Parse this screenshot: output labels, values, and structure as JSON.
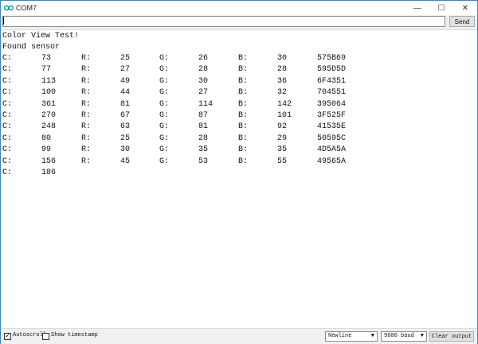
{
  "window": {
    "title": "COM7",
    "minimize": "—",
    "maximize": "☐",
    "close": "✕",
    "app_icon": "arduino-infinity-icon"
  },
  "send_row": {
    "input_value": "",
    "send_label": "Send"
  },
  "output": {
    "header_lines": [
      "Color View Test!",
      "Found sensor"
    ],
    "rows": [
      [
        "C:",
        "73",
        "R:",
        "25",
        "G:",
        "26",
        "B:",
        "30",
        "575B69"
      ],
      [
        "C:",
        "77",
        "R:",
        "27",
        "G:",
        "28",
        "B:",
        "28",
        "595D5D"
      ],
      [
        "C:",
        "113",
        "R:",
        "49",
        "G:",
        "30",
        "B:",
        "36",
        "6F4351"
      ],
      [
        "C:",
        "100",
        "R:",
        "44",
        "G:",
        "27",
        "B:",
        "32",
        "704551"
      ],
      [
        "C:",
        "361",
        "R:",
        "81",
        "G:",
        "114",
        "B:",
        "142",
        "395064"
      ],
      [
        "C:",
        "270",
        "R:",
        "67",
        "G:",
        "87",
        "B:",
        "101",
        "3F525F"
      ],
      [
        "C:",
        "248",
        "R:",
        "63",
        "G:",
        "81",
        "B:",
        "92",
        "41535E"
      ],
      [
        "C:",
        "80",
        "R:",
        "25",
        "G:",
        "28",
        "B:",
        "29",
        "50595C"
      ],
      [
        "C:",
        "99",
        "R:",
        "30",
        "G:",
        "35",
        "B:",
        "35",
        "4D5A5A"
      ],
      [
        "C:",
        "156",
        "R:",
        "45",
        "G:",
        "53",
        "B:",
        "55",
        "49565A"
      ],
      [
        "C:",
        "186"
      ]
    ]
  },
  "statusbar": {
    "autoscroll_label": "Autoscroll",
    "autoscroll_checked": true,
    "timestamp_label": "Show timestamp",
    "timestamp_checked": false,
    "line_ending": "Newline",
    "baud": "9600 baud",
    "clear_label": "Clear output"
  },
  "colors": {
    "accent": "#2b88d8",
    "arduino_teal": "#00979c"
  }
}
